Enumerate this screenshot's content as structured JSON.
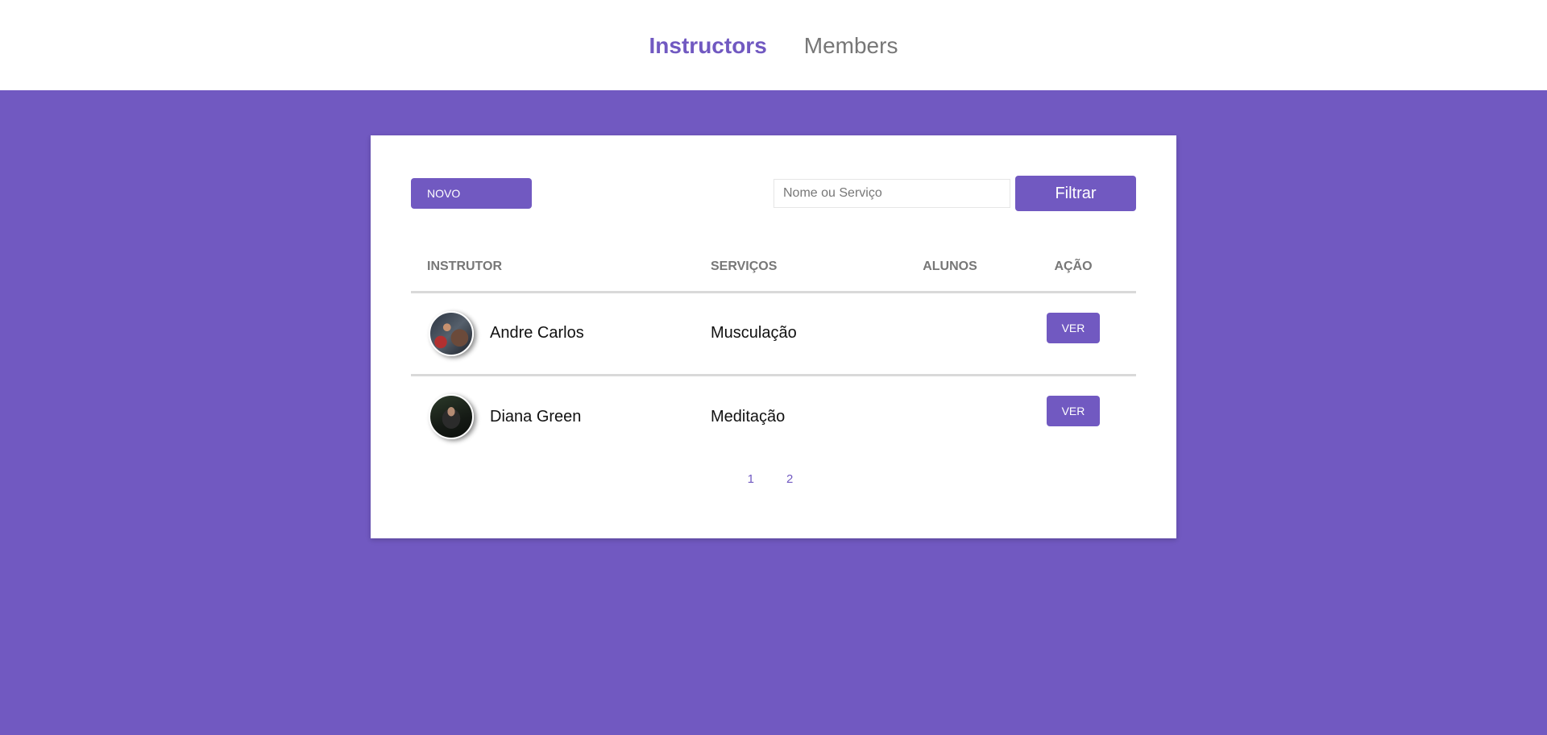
{
  "nav": {
    "instructors_label": "Instructors",
    "members_label": "Members"
  },
  "toolbar": {
    "new_label": "NOVO",
    "search_placeholder": "Nome ou Serviço",
    "search_value": "",
    "filter_label": "Filtrar"
  },
  "table": {
    "headers": {
      "instrutor": "INSTRUTOR",
      "servicos": "SERVIÇOS",
      "alunos": "ALUNOS",
      "acao": "AÇÃO"
    },
    "rows": [
      {
        "name": "Andre Carlos",
        "services": "Musculação",
        "members": "",
        "action_label": "VER"
      },
      {
        "name": "Diana Green",
        "services": "Meditação",
        "members": "",
        "action_label": "VER"
      }
    ]
  },
  "pagination": {
    "pages": [
      "1",
      "2"
    ]
  },
  "colors": {
    "accent": "#7159c1",
    "muted_text": "#777777"
  }
}
